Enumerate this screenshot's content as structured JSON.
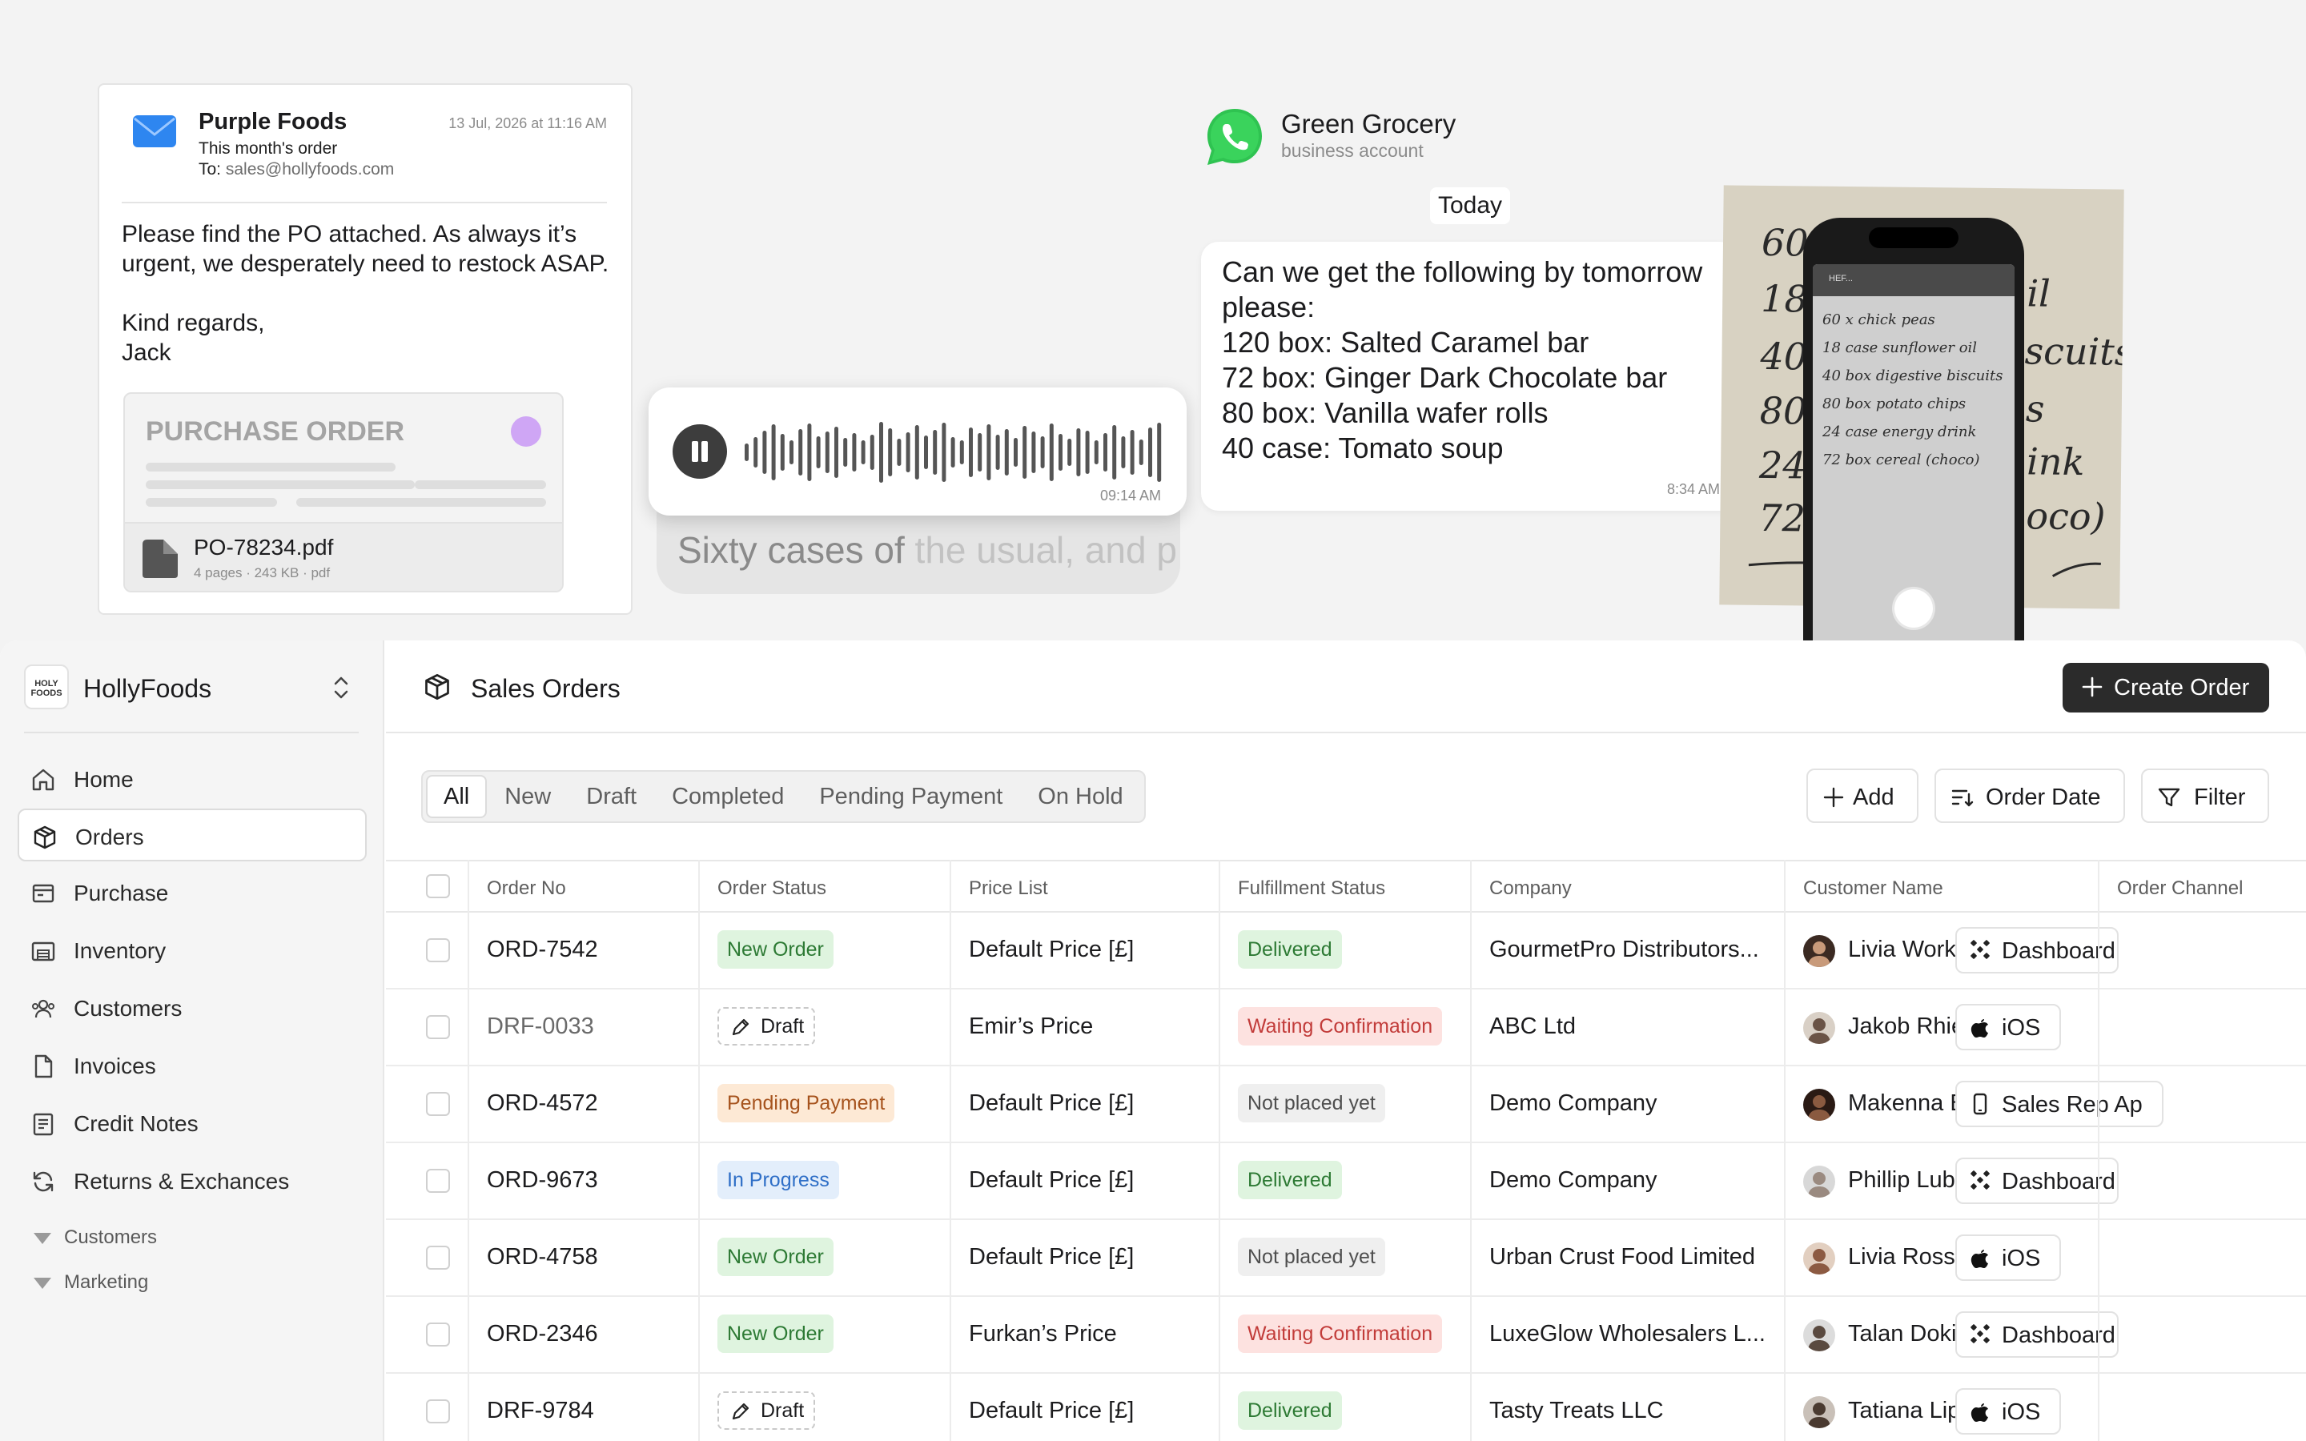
{
  "email": {
    "sender": "Purple Foods",
    "subject": "This month's order",
    "to_label": "To:",
    "to_address": "sales@hollyfoods.com",
    "date": "13 Jul, 2026 at 11:16 AM",
    "body_1": "Please find the PO attached. As always it’s urgent, we desperately need to restock ASAP.",
    "body_2": "Kind regards,",
    "body_3": "Jack",
    "attachment_title": "PURCHASE ORDER",
    "attachment_name": "PO-78234.pdf",
    "attachment_meta": "4 pages · 243 KB · pdf"
  },
  "voice_note": {
    "time": "09:14 AM",
    "transcript_spoken": "Sixty cases of",
    "transcript_pending": " the usual, and p"
  },
  "whatsapp": {
    "name": "Green Grocery",
    "subtitle": "business account",
    "day_label": "Today",
    "message_lines": [
      "Can we get the following by tomorrow",
      "please:",
      "",
      "120 box: Salted Caramel bar",
      "72 box: Ginger Dark Chocolate bar",
      "80 box: Vanilla wafer rolls",
      "40 case: Tomato soup"
    ],
    "time": "8:34 AM"
  },
  "handwritten_note": {
    "paper_fragments": [
      "60",
      "18",
      "40",
      "80",
      "24",
      "72",
      "il",
      "scuits",
      "s",
      "ink",
      "oco)"
    ],
    "phone_status": "HEF...",
    "phone_lines": [
      "60 x  chick peas",
      "18 case  sunflower oil",
      "40 box  digestive biscuits",
      "80 box  potato chips",
      "24 case  energy drink",
      "72 box  cereal (choco)"
    ]
  },
  "app": {
    "brand": {
      "logo_text": "HOLY FOODS",
      "name": "HollyFoods"
    },
    "nav": [
      {
        "label": "Home",
        "icon": "home-icon"
      },
      {
        "label": "Orders",
        "icon": "box-icon",
        "active": true
      },
      {
        "label": "Purchase",
        "icon": "purchase-icon"
      },
      {
        "label": "Inventory",
        "icon": "warehouse-icon"
      },
      {
        "label": "Customers",
        "icon": "users-icon"
      },
      {
        "label": "Invoices",
        "icon": "document-icon"
      },
      {
        "label": "Credit Notes",
        "icon": "receipt-icon"
      },
      {
        "label": "Returns & Exchances",
        "icon": "return-icon"
      }
    ],
    "nav_groups": [
      "Customers",
      "Marketing"
    ],
    "page_title": "Sales Orders",
    "create_button": "Create Order",
    "tabs": [
      "All",
      "New",
      "Draft",
      "Completed",
      "Pending Payment",
      "On Hold"
    ],
    "active_tab": "All",
    "toolbar": {
      "add": "Add",
      "order_date": "Order Date",
      "filter": "Filter"
    },
    "columns": [
      "Order No",
      "Order Status",
      "Price List",
      "Fulfillment Status",
      "Company",
      "Customer Name",
      "Order Channel"
    ],
    "rows": [
      {
        "order_no": "ORD-7542",
        "status": "New Order",
        "price_list": "Default Price [£]",
        "fulfillment": "Delivered",
        "company": "GourmetPro Distributors...",
        "customer": "Livia Workman",
        "channel": "Dashboard"
      },
      {
        "order_no": "DRF-0033",
        "status": "Draft",
        "price_list": "Emir’s Price",
        "fulfillment": "Waiting Confirmation",
        "company": "ABC Ltd",
        "customer": "Jakob Rhiel Madsen",
        "channel": "iOS"
      },
      {
        "order_no": "ORD-4572",
        "status": "Pending Payment",
        "price_list": "Default Price [£]",
        "fulfillment": "Not placed yet",
        "company": "Demo Company",
        "customer": "Makenna Baptista",
        "channel": "Sales Rep Ap"
      },
      {
        "order_no": "ORD-9673",
        "status": "In Progress",
        "price_list": "Default Price [£]",
        "fulfillment": "Delivered",
        "company": "Demo Company",
        "customer": "Phillip Lubin",
        "channel": "Dashboard"
      },
      {
        "order_no": "ORD-4758",
        "status": "New Order",
        "price_list": "Default Price [£]",
        "fulfillment": "Not placed yet",
        "company": "Urban Crust Food Limited",
        "customer": "Livia Rosser",
        "channel": "iOS"
      },
      {
        "order_no": "ORD-2346",
        "status": "New Order",
        "price_list": "Furkan’s Price",
        "fulfillment": "Waiting Confirmation",
        "company": "LuxeGlow Wholesalers L...",
        "customer": "Talan Dokidis",
        "channel": "Dashboard"
      },
      {
        "order_no": "DRF-9784",
        "status": "Draft",
        "price_list": "Default Price [£]",
        "fulfillment": "Delivered",
        "company": "Tasty Treats LLC",
        "customer": "Tatiana Lipshutz",
        "channel": "iOS"
      }
    ]
  }
}
